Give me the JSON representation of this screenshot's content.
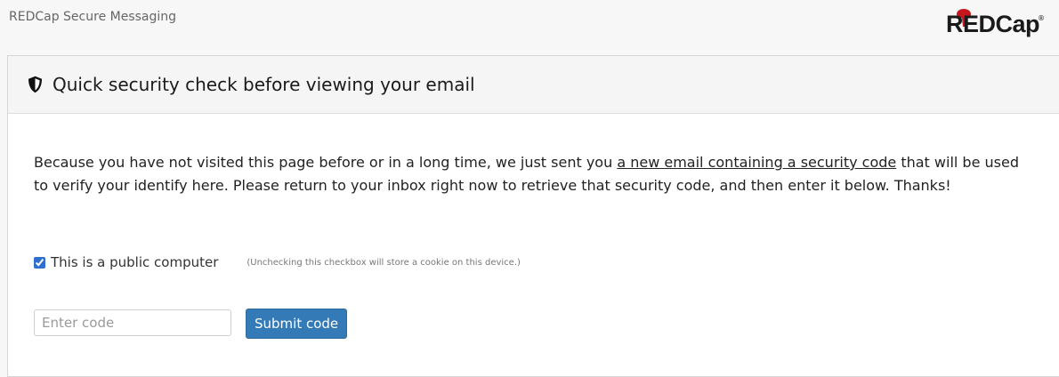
{
  "app": {
    "title": "REDCap Secure Messaging",
    "logo_text": "REDCap",
    "logo_reg": "®"
  },
  "card": {
    "title": "Quick security check before viewing your email",
    "header_icon": "shield-half-icon",
    "message_before_link": "Because you have not visited this page before or in a long time, we just sent you ",
    "message_link": "a new email containing a security code",
    "message_after_link": " that will be used to verify your identify here. Please return to your inbox right now to retrieve that security code, and then enter it below. Thanks!"
  },
  "form": {
    "public_computer_label": "This is a public computer",
    "public_computer_checked": true,
    "public_computer_note": "(Unchecking this checkbox will store a cookie on this device.)",
    "code_placeholder": "Enter code",
    "code_value": "",
    "submit_label": "Submit code"
  },
  "colors": {
    "accent": "#337ab7",
    "logo_red": "#c4161c"
  }
}
